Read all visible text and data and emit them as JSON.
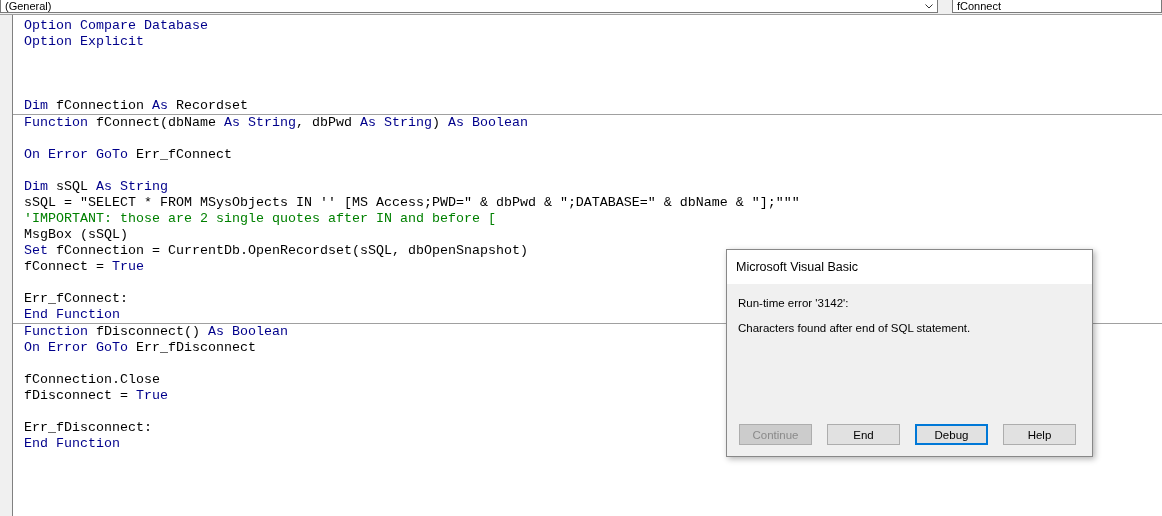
{
  "object_box": {
    "value": "(General)"
  },
  "procedure_box": {
    "value": "fConnect"
  },
  "sections": [
    {
      "lines": [
        {
          "kind": "code",
          "tokens": [
            {
              "kind": "keyword",
              "text": "Option Compare Database"
            }
          ]
        },
        {
          "kind": "code",
          "tokens": [
            {
              "kind": "keyword",
              "text": "Option Explicit"
            }
          ]
        },
        {
          "kind": "blank"
        },
        {
          "kind": "blank"
        },
        {
          "kind": "blank"
        },
        {
          "kind": "code",
          "tokens": [
            {
              "kind": "keyword",
              "text": "Dim"
            },
            {
              "kind": "plain",
              "text": " fConnection "
            },
            {
              "kind": "keyword",
              "text": "As"
            },
            {
              "kind": "plain",
              "text": " Recordset"
            }
          ]
        }
      ]
    },
    {
      "lines": [
        {
          "kind": "code",
          "tokens": [
            {
              "kind": "keyword",
              "text": "Function"
            },
            {
              "kind": "plain",
              "text": " fConnect(dbName "
            },
            {
              "kind": "keyword",
              "text": "As String"
            },
            {
              "kind": "plain",
              "text": ", dbPwd "
            },
            {
              "kind": "keyword",
              "text": "As String"
            },
            {
              "kind": "plain",
              "text": ") "
            },
            {
              "kind": "keyword",
              "text": "As Boolean"
            }
          ]
        },
        {
          "kind": "blank"
        },
        {
          "kind": "code",
          "tokens": [
            {
              "kind": "keyword",
              "text": "On Error GoTo"
            },
            {
              "kind": "plain",
              "text": " Err_fConnect"
            }
          ]
        },
        {
          "kind": "blank"
        },
        {
          "kind": "code",
          "tokens": [
            {
              "kind": "keyword",
              "text": "Dim"
            },
            {
              "kind": "plain",
              "text": " sSQL "
            },
            {
              "kind": "keyword",
              "text": "As String"
            }
          ]
        },
        {
          "kind": "code",
          "tokens": [
            {
              "kind": "plain",
              "text": "sSQL = \"SELECT * FROM MSysObjects IN '' [MS Access;PWD=\" & dbPwd & \";DATABASE=\" & dbName & \"];\"\"\""
            }
          ]
        },
        {
          "kind": "code",
          "tokens": [
            {
              "kind": "comment",
              "text": "'IMPORTANT: those are 2 single quotes after IN and before ["
            }
          ]
        },
        {
          "kind": "code",
          "tokens": [
            {
              "kind": "plain",
              "text": "MsgBox (sSQL)"
            }
          ]
        },
        {
          "kind": "code",
          "tokens": [
            {
              "kind": "keyword",
              "text": "Set"
            },
            {
              "kind": "plain",
              "text": " fConnection = CurrentDb.OpenRecordset(sSQL, dbOpenSnapshot)"
            }
          ]
        },
        {
          "kind": "code",
          "tokens": [
            {
              "kind": "plain",
              "text": "fConnect = "
            },
            {
              "kind": "keyword",
              "text": "True"
            }
          ]
        },
        {
          "kind": "blank"
        },
        {
          "kind": "code",
          "tokens": [
            {
              "kind": "plain",
              "text": "Err_fConnect:"
            }
          ]
        },
        {
          "kind": "code",
          "tokens": [
            {
              "kind": "keyword",
              "text": "End Function"
            }
          ]
        }
      ]
    },
    {
      "lines": [
        {
          "kind": "code",
          "tokens": [
            {
              "kind": "keyword",
              "text": "Function"
            },
            {
              "kind": "plain",
              "text": " fDisconnect() "
            },
            {
              "kind": "keyword",
              "text": "As Boolean"
            }
          ]
        },
        {
          "kind": "code",
          "tokens": [
            {
              "kind": "keyword",
              "text": "On Error GoTo"
            },
            {
              "kind": "plain",
              "text": " Err_fDisconnect"
            }
          ]
        },
        {
          "kind": "blank"
        },
        {
          "kind": "code",
          "tokens": [
            {
              "kind": "plain",
              "text": "fConnection.Close"
            }
          ]
        },
        {
          "kind": "code",
          "tokens": [
            {
              "kind": "plain",
              "text": "fDisconnect = "
            },
            {
              "kind": "keyword",
              "text": "True"
            }
          ]
        },
        {
          "kind": "blank"
        },
        {
          "kind": "code",
          "tokens": [
            {
              "kind": "plain",
              "text": "Err_fDisconnect:"
            }
          ]
        },
        {
          "kind": "code",
          "tokens": [
            {
              "kind": "keyword",
              "text": "End Function"
            }
          ]
        }
      ]
    }
  ],
  "dialog": {
    "title": "Microsoft Visual Basic",
    "error": "Run-time error '3142':",
    "message": "Characters found after end of SQL statement.",
    "buttons": [
      {
        "label": "Continue",
        "disabled": true,
        "focused": false
      },
      {
        "label": "End",
        "disabled": false,
        "focused": false
      },
      {
        "label": "Debug",
        "disabled": false,
        "focused": true
      },
      {
        "label": "Help",
        "disabled": false,
        "focused": false
      }
    ]
  }
}
